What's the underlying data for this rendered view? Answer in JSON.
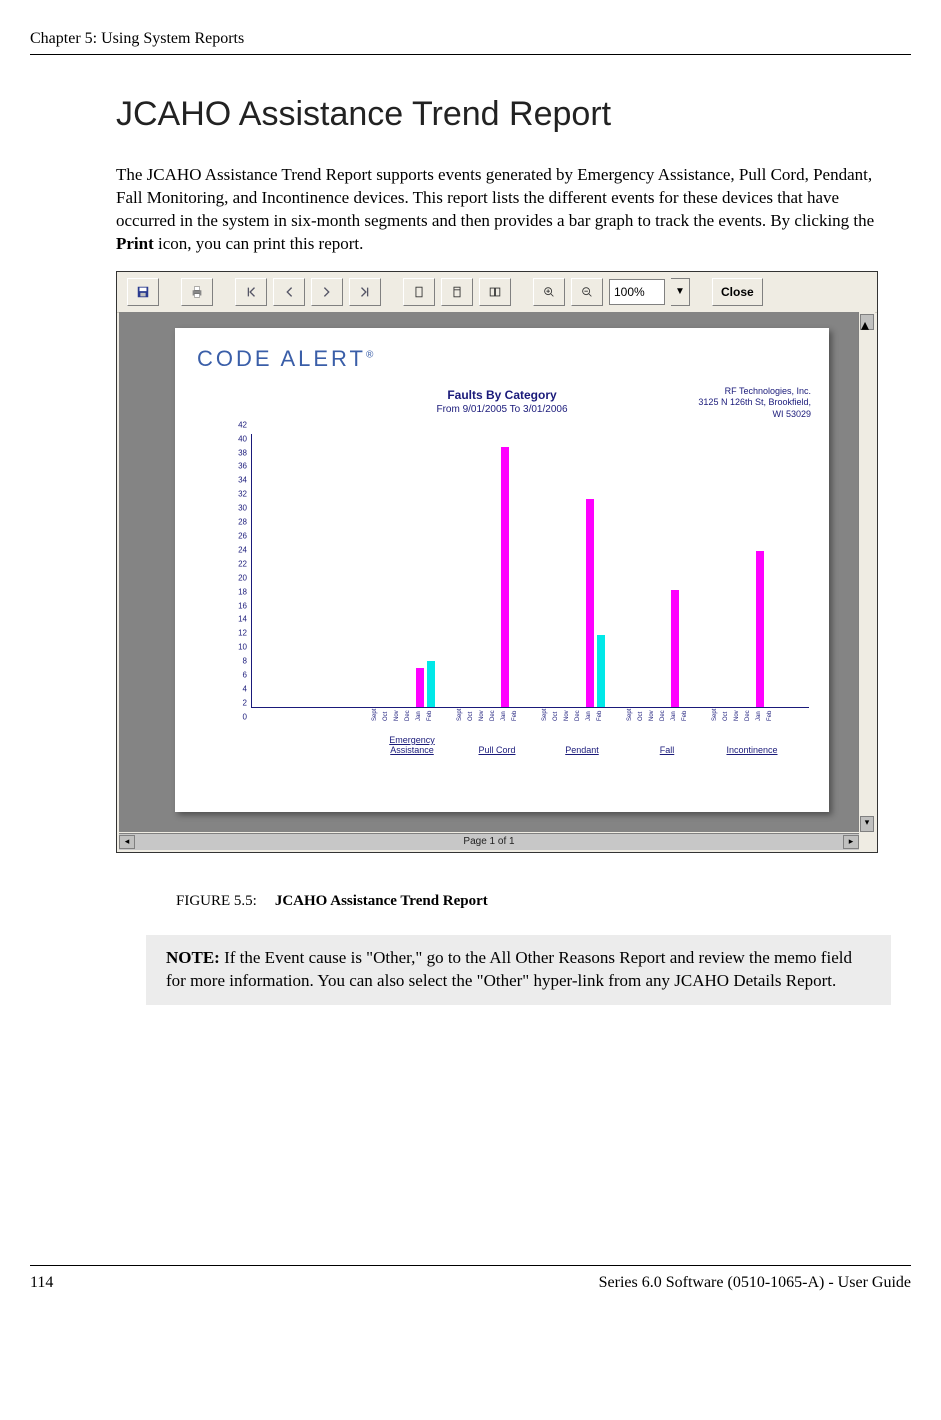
{
  "running_head": "Chapter 5: Using System Reports",
  "heading": "JCAHO Assistance Trend Report",
  "paragraph_parts": {
    "p1": "The JCAHO Assistance Trend Report supports events generated by Emergency Assistance, Pull Cord, Pendant, Fall Monitoring, and Incontinence devices. This report lists the different events for these devices that have occurred in the system in six-month segments and then provides a bar graph to track the events. By clicking the ",
    "p1_bold": "Print",
    "p1_tail": " icon, you can print this report."
  },
  "toolbar": {
    "zoom": "100%",
    "close": "Close"
  },
  "scroll_footer": "Page 1 of 1",
  "report": {
    "logo": "CODE ALERT",
    "title": "Faults By Category",
    "subtitle": "From 9/01/2005 To 3/01/2006",
    "org_line1": "RF Technologies, Inc.",
    "org_line2": "3125 N 126th St, Brookfield,",
    "org_line3": "WI 53029"
  },
  "chart_data": {
    "type": "bar",
    "ylim": [
      0,
      42
    ],
    "y_ticks": [
      0,
      2,
      4,
      6,
      8,
      10,
      12,
      14,
      16,
      18,
      20,
      22,
      24,
      26,
      28,
      30,
      32,
      34,
      36,
      38,
      40,
      42
    ],
    "sub_labels": [
      "Sept",
      "Oct",
      "Nov",
      "Dec",
      "Jan",
      "Feb"
    ],
    "colors_by_sub": [
      "#ff00ff",
      "#ff00ff",
      "#ff00ff",
      "#ff00ff",
      "#ff00ff",
      "#00e8e8"
    ],
    "categories": [
      "Emergency Assistance",
      "Pull Cord",
      "Pendant",
      "Fall",
      "Incontinence"
    ],
    "series_matrix": [
      [
        0,
        0,
        0,
        0,
        6,
        7
      ],
      [
        0,
        0,
        0,
        0,
        40,
        0
      ],
      [
        0,
        0,
        0,
        0,
        32,
        11
      ],
      [
        0,
        0,
        0,
        0,
        18,
        0
      ],
      [
        0,
        0,
        0,
        0,
        24,
        0
      ]
    ]
  },
  "caption": {
    "num": "FIGURE 5.5:",
    "text": "JCAHO Assistance Trend Report"
  },
  "note": {
    "lead": "NOTE:",
    "body": " If the Event cause is \"Other,\" go to the All Other Reasons Report and review the memo field for more information. You can also select the \"Other\" hyper-link from any JCAHO Details Report."
  },
  "footer": {
    "page_num": "114",
    "doc": "Series 6.0 Software (0510-1065-A) - User Guide"
  }
}
